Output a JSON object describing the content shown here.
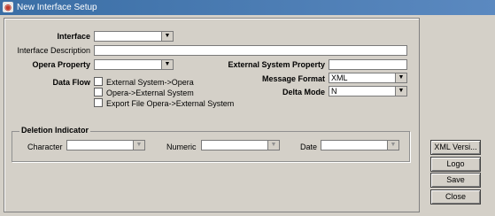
{
  "window": {
    "title": "New Interface Setup",
    "icon": "oracle-app-icon"
  },
  "form": {
    "interface_label": "Interface",
    "interface_value": "",
    "interface_description_label": "Interface Description",
    "interface_description_value": "",
    "opera_property_label": "Opera Property",
    "opera_property_value": "",
    "external_system_property_label": "External System Property",
    "external_system_property_value": "",
    "data_flow_label": "Data Flow",
    "data_flow_options": [
      {
        "label": "External System->Opera",
        "checked": false
      },
      {
        "label": "Opera->External System",
        "checked": false
      },
      {
        "label": "Export File Opera->External System",
        "checked": false
      }
    ],
    "message_format_label": "Message Format",
    "message_format_value": "XML",
    "delta_mode_label": "Delta Mode",
    "delta_mode_value": "N"
  },
  "deletion_indicator": {
    "title": "Deletion Indicator",
    "character_label": "Character",
    "character_value": "",
    "numeric_label": "Numeric",
    "numeric_value": "",
    "date_label": "Date",
    "date_value": ""
  },
  "buttons": {
    "xml_version": "XML Versi...",
    "logo": "Logo",
    "save": "Save",
    "close": "Close"
  },
  "icons": {
    "dropdown": "down-arrow-icon"
  }
}
